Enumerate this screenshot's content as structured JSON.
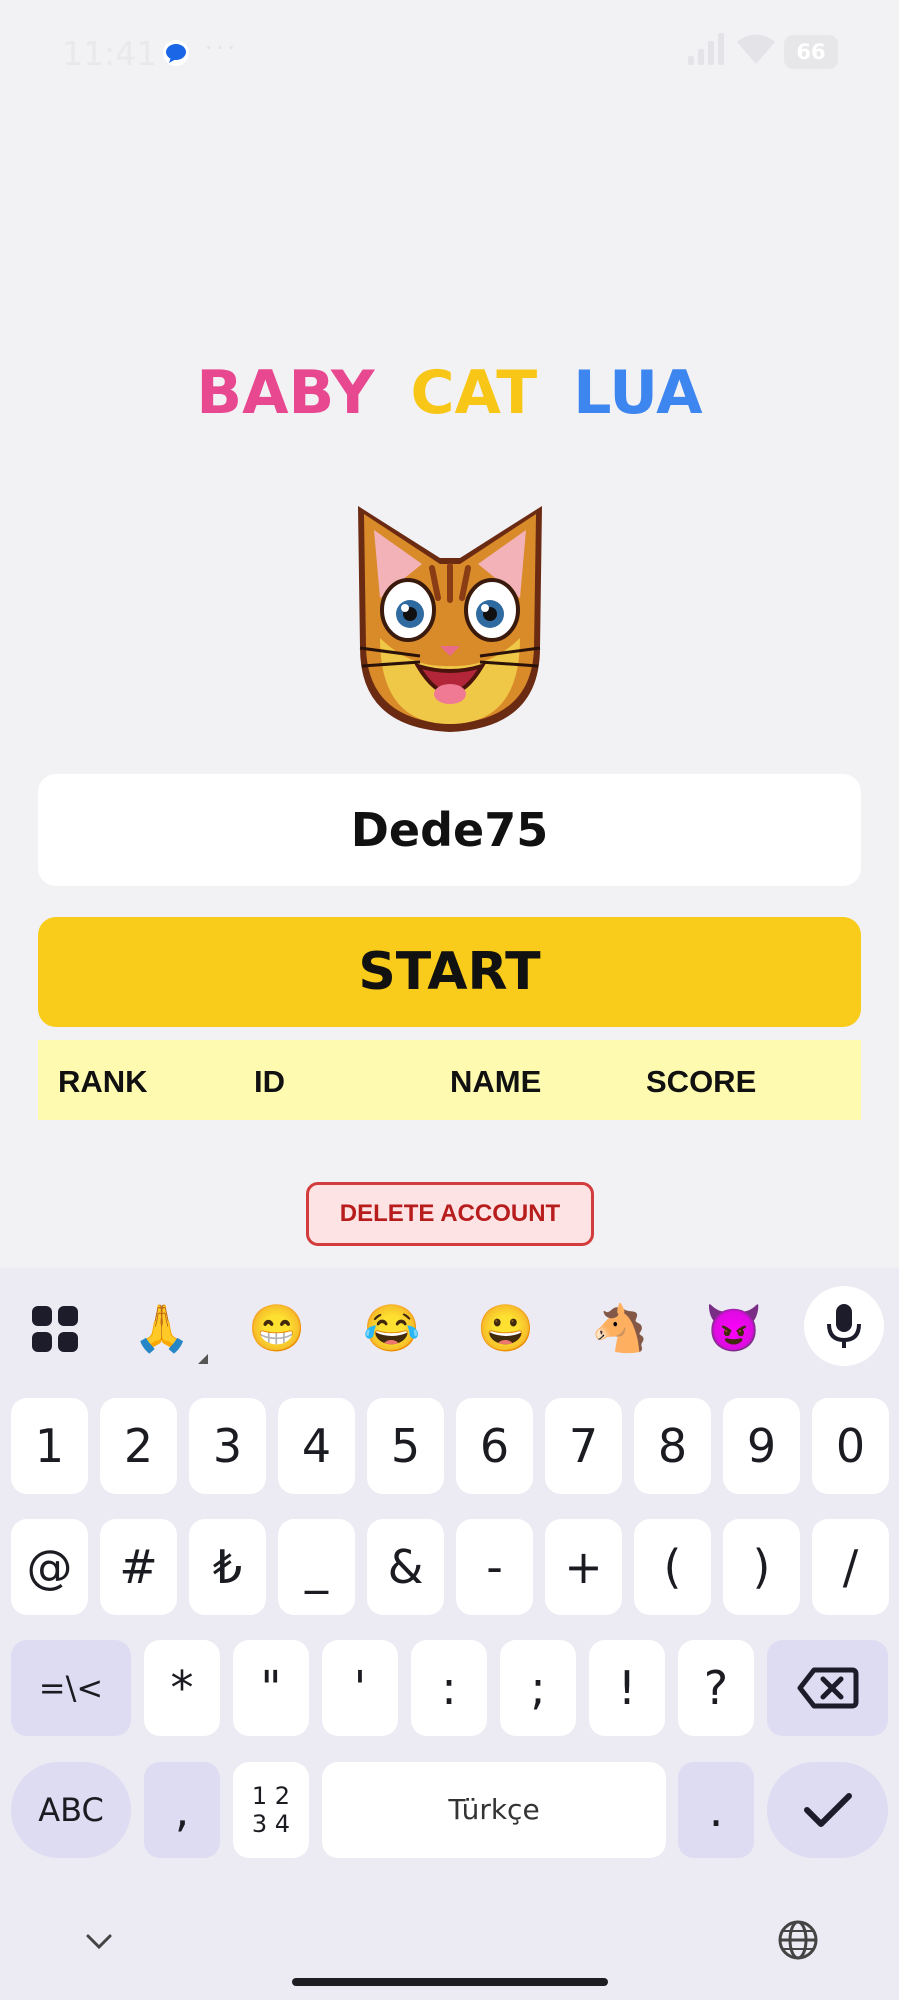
{
  "status_bar": {
    "time": "11:41",
    "dots": "···",
    "battery": "66",
    "icons": [
      "message-icon",
      "signal-icon",
      "wifi-icon",
      "battery-icon"
    ]
  },
  "title": {
    "word1": "BABY",
    "word2": "CAT",
    "word3": "LUA",
    "colors": [
      "#e8488f",
      "#f8c616",
      "#3d86ef"
    ]
  },
  "name_input": {
    "value": "Dede75"
  },
  "start_button": {
    "label": "START",
    "color": "#f9cb1a"
  },
  "leaderboard": {
    "headers": [
      "RANK",
      "ID",
      "NAME",
      "SCORE"
    ]
  },
  "delete_button": {
    "label": "DELETE ACCOUNT"
  },
  "keyboard": {
    "suggestions": [
      "🙏",
      "😁",
      "😂",
      "😀",
      "🐴",
      "😈"
    ],
    "row1": [
      "1",
      "2",
      "3",
      "4",
      "5",
      "6",
      "7",
      "8",
      "9",
      "0"
    ],
    "row2": [
      "@",
      "#",
      "₺",
      "_",
      "&",
      "-",
      "+",
      "(",
      ")",
      "/"
    ],
    "row3": [
      "=\\<",
      "*",
      "\"",
      "'",
      ":",
      ";",
      "!",
      "?"
    ],
    "row4": {
      "abc": "ABC",
      "comma": ",",
      "nums_top": "1 2",
      "nums_bottom": "3 4",
      "space": "Türkçe",
      "period": "."
    }
  }
}
